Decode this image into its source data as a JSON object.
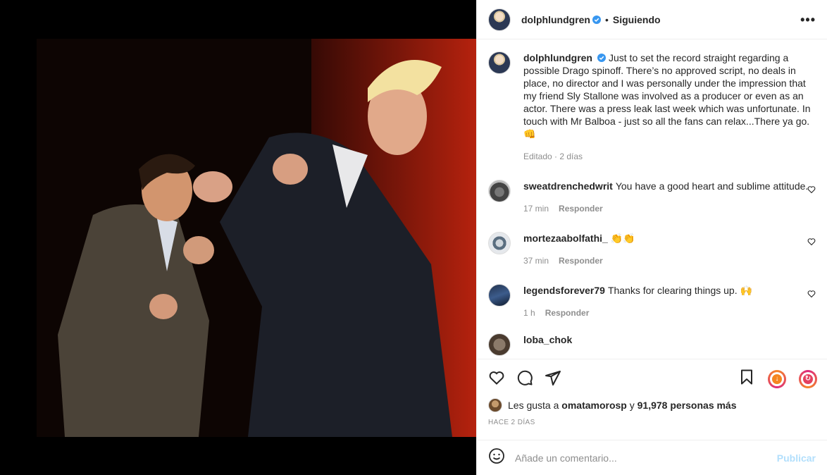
{
  "post": {
    "username": "dolphlundgren",
    "dot": "•",
    "follow_label": "Siguiendo",
    "more_label": "•••",
    "caption": "Just to set the record straight regarding a possible Drago spinoff. There’s no approved script, no deals in place, no director and I was personally under the impression that my friend Sly Stallone was involved as a producer or even as an actor. There was a press leak last week which was unfortunate. In touch with Mr Balboa - just so all the fans can relax...There ya go. 👊",
    "caption_meta": "Editado · 2 días"
  },
  "comments": [
    {
      "user": "sweatdrenchedwrit",
      "text": "You have a good heart and sublime attitude.",
      "time": "17 min",
      "reply": "Responder",
      "avatar": "sweat"
    },
    {
      "user": "mortezaabolfathi_",
      "text": "👏👏",
      "time": "37 min",
      "reply": "Responder",
      "avatar": "mort"
    },
    {
      "user": "legendsforever79",
      "text": "Thanks for clearing things up. 🙌",
      "time": "1 h",
      "reply": "Responder",
      "avatar": "legends"
    },
    {
      "user": "loba_chok",
      "text": "",
      "time": "",
      "reply": "",
      "avatar": "loba"
    }
  ],
  "actions": {
    "icons": [
      "heart-icon",
      "comment-icon",
      "share-icon",
      "save-icon",
      "reel-icon-1",
      "reel-icon-2"
    ]
  },
  "likes": {
    "prefix": "Les gusta a",
    "user": "omatamorosp",
    "middle": "y",
    "count_text": "91,978 personas más"
  },
  "posted_ago": "HACE 2 DÍAS",
  "add_comment": {
    "placeholder": "Añade un comentario...",
    "publish_label": "Publicar"
  },
  "colors": {
    "verified": "#3897f0",
    "publish": "#b2dffc",
    "meta": "#8e8e8e",
    "reel_ring_1": "#f58529",
    "reel_ring_2": "#dd2a7b"
  }
}
